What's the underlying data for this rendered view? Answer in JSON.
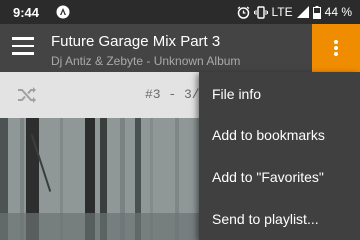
{
  "status_bar": {
    "time": "9:44",
    "network": "LTE",
    "battery": "44 %"
  },
  "app_bar": {
    "title": "Future Garage Mix Part 3",
    "subtitle": "Dj Antiz & Zebyte - Unknown Album",
    "accent_color": "#f08c00"
  },
  "controls": {
    "track_position": "#3 - 3/"
  },
  "menu": {
    "items": [
      {
        "label": "File info"
      },
      {
        "label": "Add to bookmarks"
      },
      {
        "label": "Add to \"Favorites\""
      },
      {
        "label": "Send to playlist..."
      }
    ]
  }
}
